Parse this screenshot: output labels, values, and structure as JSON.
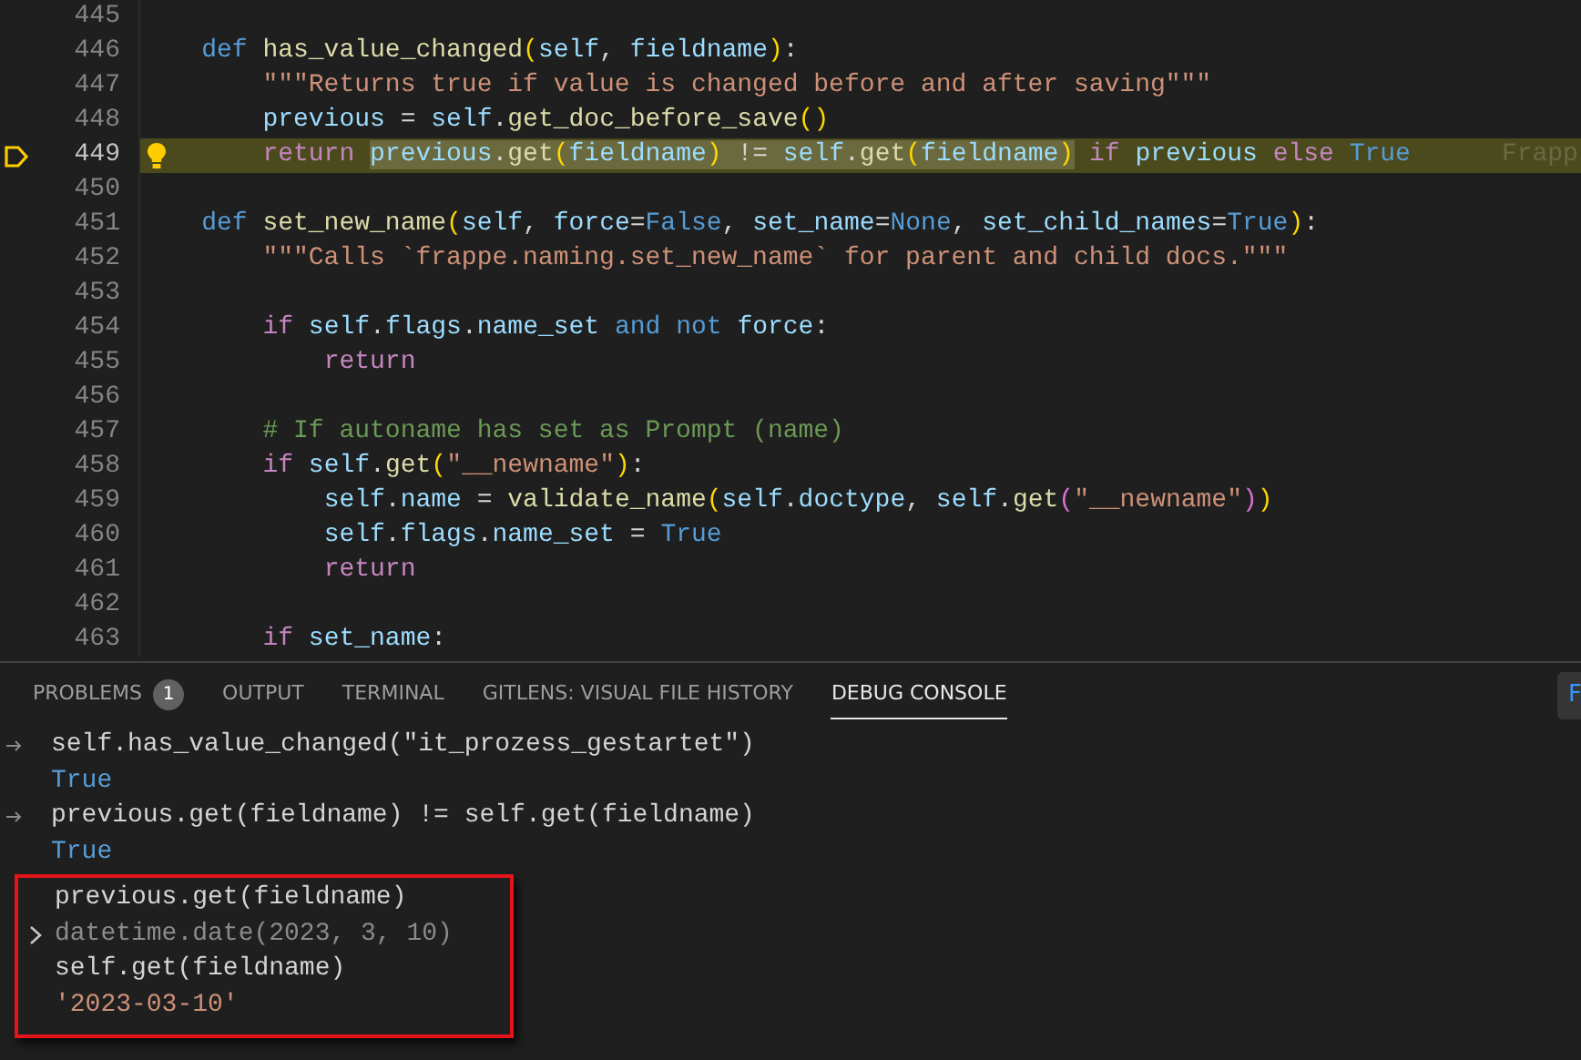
{
  "editor": {
    "lines": [
      {
        "number": "445",
        "current": false
      },
      {
        "number": "446",
        "current": false,
        "tokens": [
          {
            "text": "def ",
            "kind": "keyword"
          },
          {
            "text": "has_value_changed",
            "kind": "function"
          },
          {
            "text": "(",
            "kind": "bracket"
          },
          {
            "text": "self",
            "kind": "variable"
          },
          {
            "text": ", ",
            "kind": "plain"
          },
          {
            "text": "fieldname",
            "kind": "variable"
          },
          {
            "text": ")",
            "kind": "bracket"
          },
          {
            "text": ":",
            "kind": "plain"
          }
        ],
        "children": [
          {
            "number": "447",
            "current": false,
            "tokens": [
              {
                "text": "\"\"\"Returns true if value is changed before and after saving\"\"\"",
                "kind": "string"
              }
            ]
          },
          {
            "number": "448",
            "current": false,
            "tokens": [
              {
                "text": "previous",
                "kind": "variable"
              },
              {
                "text": " = ",
                "kind": "plain"
              },
              {
                "text": "self",
                "kind": "variable"
              },
              {
                "text": ".",
                "kind": "plain"
              },
              {
                "text": "get_doc_before_save",
                "kind": "function"
              },
              {
                "text": "()",
                "kind": "bracket"
              }
            ]
          },
          {
            "number": "449",
            "current": true,
            "lightbulb": true,
            "tokens": [
              {
                "text": "return ",
                "kind": "control",
                "selected": false
              },
              {
                "text": "previous",
                "kind": "variable",
                "selected": true
              },
              {
                "text": ".",
                "kind": "plain",
                "selected": true
              },
              {
                "text": "get",
                "kind": "function",
                "selected": true
              },
              {
                "text": "(",
                "kind": "bracket",
                "selected": true
              },
              {
                "text": "fieldname",
                "kind": "variable",
                "selected": true
              },
              {
                "text": ")",
                "kind": "bracket",
                "selected": true
              },
              {
                "text": " != ",
                "kind": "plain",
                "selected": true
              },
              {
                "text": "self",
                "kind": "variable",
                "selected": true
              },
              {
                "text": ".",
                "kind": "plain",
                "selected": true
              },
              {
                "text": "get",
                "kind": "function",
                "selected": true
              },
              {
                "text": "(",
                "kind": "bracket",
                "selected": true
              },
              {
                "text": "fieldname",
                "kind": "variable",
                "selected": true
              },
              {
                "text": ")",
                "kind": "bracket",
                "selected": true
              },
              {
                "text": " if",
                "kind": "control",
                "selected": false
              },
              {
                "text": " previous",
                "kind": "variable",
                "selected": false
              },
              {
                "text": " else",
                "kind": "control",
                "selected": false
              },
              {
                "text": " True",
                "kind": "keyword",
                "selected": false
              }
            ],
            "inline_blame": "Frapp"
          }
        ]
      },
      {
        "number": "450",
        "current": false
      },
      {
        "number": "451",
        "current": false,
        "tokens": [
          {
            "text": "def ",
            "kind": "keyword"
          },
          {
            "text": "set_new_name",
            "kind": "function"
          },
          {
            "text": "(",
            "kind": "bracket"
          },
          {
            "text": "self",
            "kind": "variable"
          },
          {
            "text": ", ",
            "kind": "plain"
          },
          {
            "text": "force",
            "kind": "variable"
          },
          {
            "text": "=",
            "kind": "plain"
          },
          {
            "text": "False",
            "kind": "keyword"
          },
          {
            "text": ", ",
            "kind": "plain"
          },
          {
            "text": "set_name",
            "kind": "variable"
          },
          {
            "text": "=",
            "kind": "plain"
          },
          {
            "text": "None",
            "kind": "keyword"
          },
          {
            "text": ", ",
            "kind": "plain"
          },
          {
            "text": "set_child_names",
            "kind": "variable"
          },
          {
            "text": "=",
            "kind": "plain"
          },
          {
            "text": "True",
            "kind": "keyword"
          },
          {
            "text": ")",
            "kind": "bracket"
          },
          {
            "text": ":",
            "kind": "plain"
          }
        ],
        "children": [
          {
            "number": "452",
            "current": false,
            "tokens": [
              {
                "text": "\"\"\"Calls `frappe.naming.set_new_name` for parent and child docs.\"\"\"",
                "kind": "string"
              }
            ]
          },
          {
            "number": "453",
            "current": false
          },
          {
            "number": "454",
            "current": false,
            "tokens": [
              {
                "text": "if ",
                "kind": "control"
              },
              {
                "text": "self",
                "kind": "variable"
              },
              {
                "text": ".",
                "kind": "plain"
              },
              {
                "text": "flags",
                "kind": "variable"
              },
              {
                "text": ".",
                "kind": "plain"
              },
              {
                "text": "name_set",
                "kind": "variable"
              },
              {
                "text": " and not",
                "kind": "keyword"
              },
              {
                "text": " force",
                "kind": "variable"
              },
              {
                "text": ":",
                "kind": "plain"
              }
            ],
            "children": [
              {
                "number": "455",
                "current": false,
                "tokens": [
                  {
                    "text": "return",
                    "kind": "control"
                  }
                ]
              }
            ]
          },
          {
            "number": "456",
            "current": false
          },
          {
            "number": "457",
            "current": false,
            "tokens": [
              {
                "text": "# If autoname has set as Prompt (name)",
                "kind": "comment"
              }
            ]
          },
          {
            "number": "458",
            "current": false,
            "tokens": [
              {
                "text": "if ",
                "kind": "control"
              },
              {
                "text": "self",
                "kind": "variable"
              },
              {
                "text": ".",
                "kind": "plain"
              },
              {
                "text": "get",
                "kind": "function"
              },
              {
                "text": "(",
                "kind": "bracket"
              },
              {
                "text": "\"__newname\"",
                "kind": "string"
              },
              {
                "text": ")",
                "kind": "bracket"
              },
              {
                "text": ":",
                "kind": "plain"
              }
            ],
            "children": [
              {
                "number": "459",
                "current": false,
                "tokens": [
                  {
                    "text": "self",
                    "kind": "variable"
                  },
                  {
                    "text": ".",
                    "kind": "plain"
                  },
                  {
                    "text": "name",
                    "kind": "variable"
                  },
                  {
                    "text": " = ",
                    "kind": "plain"
                  },
                  {
                    "text": "validate_name",
                    "kind": "function"
                  },
                  {
                    "text": "(",
                    "kind": "bracket"
                  },
                  {
                    "text": "self",
                    "kind": "variable"
                  },
                  {
                    "text": ".",
                    "kind": "plain"
                  },
                  {
                    "text": "doctype",
                    "kind": "variable"
                  },
                  {
                    "text": ", ",
                    "kind": "plain"
                  },
                  {
                    "text": "self",
                    "kind": "variable"
                  },
                  {
                    "text": ".",
                    "kind": "plain"
                  },
                  {
                    "text": "get",
                    "kind": "function"
                  },
                  {
                    "text": "(",
                    "kind": "bracket2"
                  },
                  {
                    "text": "\"__newname\"",
                    "kind": "string"
                  },
                  {
                    "text": ")",
                    "kind": "bracket2"
                  },
                  {
                    "text": ")",
                    "kind": "bracket"
                  }
                ]
              },
              {
                "number": "460",
                "current": false,
                "tokens": [
                  {
                    "text": "self",
                    "kind": "variable"
                  },
                  {
                    "text": ".",
                    "kind": "plain"
                  },
                  {
                    "text": "flags",
                    "kind": "variable"
                  },
                  {
                    "text": ".",
                    "kind": "plain"
                  },
                  {
                    "text": "name_set",
                    "kind": "variable"
                  },
                  {
                    "text": " = ",
                    "kind": "plain"
                  },
                  {
                    "text": "True",
                    "kind": "keyword"
                  }
                ]
              },
              {
                "number": "461",
                "current": false,
                "tokens": [
                  {
                    "text": "return",
                    "kind": "control"
                  }
                ]
              }
            ]
          },
          {
            "number": "462",
            "current": false
          },
          {
            "number": "463",
            "current": false,
            "tokens": [
              {
                "text": "if ",
                "kind": "control"
              },
              {
                "text": "set_name",
                "kind": "variable"
              },
              {
                "text": ":",
                "kind": "plain"
              }
            ]
          }
        ]
      }
    ]
  },
  "panel": {
    "tabs": [
      {
        "label": "PROBLEMS",
        "badge": "1",
        "selected": false
      },
      {
        "label": "OUTPUT",
        "selected": false
      },
      {
        "label": "TERMINAL",
        "selected": false
      },
      {
        "label": "GITLENS: VISUAL FILE HISTORY",
        "selected": false
      },
      {
        "label": "DEBUG CONSOLE",
        "selected": true
      }
    ],
    "corner_button": "F",
    "console": [
      {
        "kind": "input",
        "text": "self.has_value_changed(\"it_prozess_gestartet\")"
      },
      {
        "kind": "keyword",
        "text": "True"
      },
      {
        "kind": "input",
        "text": "previous.get(fieldname) != self.get(fieldname)"
      },
      {
        "kind": "keyword",
        "text": "True"
      }
    ],
    "highlight_box": [
      {
        "kind": "echo",
        "text": "previous.get(fieldname)"
      },
      {
        "kind": "object",
        "text": "datetime.date(2023, 3, 10)",
        "expanded": false
      },
      {
        "kind": "echo",
        "text": "self.get(fieldname)"
      },
      {
        "kind": "string",
        "text": "'2023-03-10'"
      }
    ]
  }
}
